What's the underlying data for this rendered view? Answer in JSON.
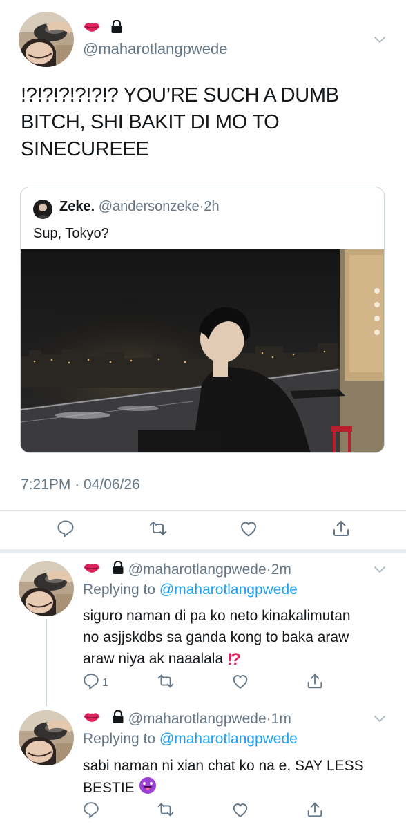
{
  "main_tweet": {
    "lips_icon": "lips-emoji",
    "lock_icon": "lock-icon",
    "handle": "@maharotlangpwede",
    "text_line1": "!?!?!?!?!?!? YOU’RE SUCH A DUMB",
    "text_line2": "BITCH, SHI BAKIT DI MO TO",
    "text_line3": "SINECUREEE",
    "quote": {
      "name": "Zeke.",
      "handle": "@andersonzeke",
      "separator": "·",
      "time": "2h",
      "text": "Sup, Tokyo?"
    },
    "timestamp": "7:21PM · 04/06/26"
  },
  "replies": [
    {
      "handle": "@maharotlangpwede",
      "separator": "·",
      "time": "2m",
      "replying_prefix": "Replying to",
      "replying_to": "@maharotlangpwede",
      "line1": "siguro naman di pa ko neto kinakalimutan",
      "line2": "no asjjskdbs sa ganda kong to baka araw",
      "line3": "araw niya ak naaalala",
      "reply_count": "1"
    },
    {
      "handle": "@maharotlangpwede",
      "separator": "·",
      "time": "1m",
      "replying_prefix": "Replying to",
      "replying_to": "@maharotlangpwede",
      "line1": "sabi naman ni xian chat ko na e, SAY LESS",
      "line2": "BESTIE",
      "reply_count": ""
    }
  ],
  "colors": {
    "text": "#14171a",
    "muted": "#657786",
    "link": "#1da1f2",
    "divider": "#e1e8ed"
  }
}
